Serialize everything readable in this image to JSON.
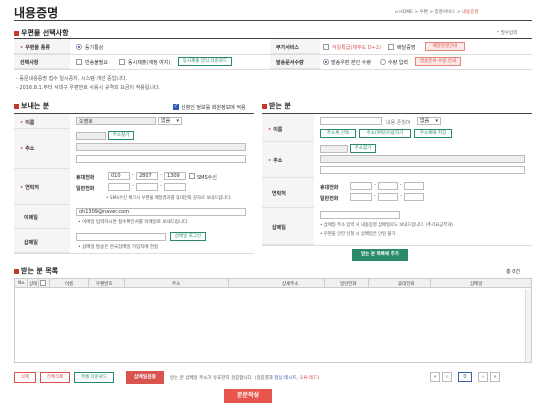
{
  "page": {
    "title": "내용증명"
  },
  "breadcrumb": {
    "home": "HOME",
    "sep": ">",
    "items": [
      "우편",
      "증명서비스",
      "내용증명"
    ]
  },
  "required_note": "* 필수입력",
  "mail_options": {
    "title": "우편물 선택사항",
    "type_label": "우편물 종류",
    "type_value": "등기통상",
    "extra_label": "부가서비스",
    "extra_opt1": "익일특급(제주도 D+2)",
    "extra_opt2": "배달증명",
    "extra_btn": "배달증명안내",
    "choice_label": "선택사항",
    "choice_opt1": "반송불필요",
    "choice_opt2": "동시제출(계정 여지)",
    "choice_btn": "동시제출 양식 다운로드",
    "sender_label": "발송문서수량",
    "sender_opt1": "발송우편 본인 수량",
    "sender_opt2": "수량 입력",
    "sender_btn": "발송문서 수량 안내"
  },
  "notices": [
    "- 동문내용증명 접수 일시중지, 시스템 개선 중입니다.",
    "- 2016.8.1.부터 서대구 우편번호 사용시 규격외 요금이 적용됩니다."
  ],
  "sender": {
    "title": "보내는 분",
    "same_check": "신청인 정보를 회원정보에 적용",
    "name_label": "이름",
    "name_value": "오영호",
    "name_select": "없음",
    "addr_label": "주소",
    "addr_btn": "주소찾기",
    "contact_label": "연락처",
    "mobile_label": "휴대전화",
    "mobile1": "010",
    "mobile2": "2807",
    "mobile3": "1309",
    "sms_label": "SMS수신",
    "phone_label": "일반전화",
    "sms_note": "• SMS수신 체크시 우편물 배달결과를 휴대전화 문자로 보내드립니다.",
    "email_label": "이메일",
    "email_value": "oh1309@naver.com",
    "email_note": "• 이메일 입력하시면 접수확인서를 이메일로 보내드립니다.",
    "seal_label": "삽메일",
    "seal_btn": "삽메일 로그인",
    "seal_note": "• 삽메일 발송은 한국삽메일 가입자에 한함"
  },
  "receiver": {
    "title": "받는 분",
    "name_label": "이름",
    "name_hint": "내용 존칭어",
    "name_select": "없음",
    "btn_select": "주소록 선택",
    "btn_bulk": "주소(여럿)이용하기",
    "btn_save": "주소록에 저장",
    "addr_label": "주소",
    "addr_btn": "주소찾기",
    "contact_label": "연락처",
    "mobile_label": "휴대전화",
    "phone_label": "일반전화",
    "seal_label": "삽메일",
    "seal_note1": "• 삽메일 주소 입력 시 내용증명 삽메일로도 보내드립니다. (추가요금부과)",
    "seal_note2": "• 우편을 안한 신청 시 삽메일은 안된 불가",
    "add_btn": "받는 분 목록에 추가"
  },
  "list": {
    "title": "받는 분 목록",
    "total": "총 0건",
    "columns": [
      "No.",
      "상태",
      "",
      "이름",
      "우편번호",
      "주소",
      "상세주소",
      "일반전화",
      "휴대전화",
      "삽메일"
    ]
  },
  "actions": {
    "delete": "삭제",
    "delete_all": "전체삭제",
    "excel": "엑셀 다운로드",
    "verify": "삽메일검증",
    "verify_note_pre": "받는 분 삽메일 주소가 유효한지 검증합니다. (검증결과 ",
    "verify_ok": "정상:레시트",
    "verify_sep": ", ",
    "verify_err": "오류:레드",
    "verify_close": ")",
    "page": "0",
    "write": "본문작성"
  },
  "colors": {
    "accent": "#d9534f",
    "green": "#2a8a6a",
    "blue": "#2f5fb3",
    "write_btn": "#e8554e"
  }
}
